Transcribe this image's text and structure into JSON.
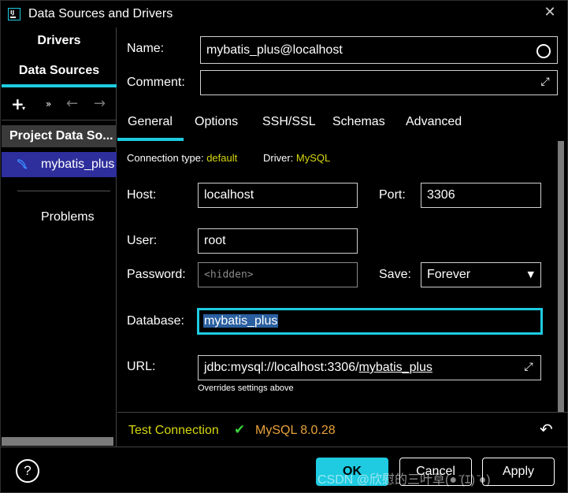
{
  "window": {
    "title": "Data Sources and Drivers",
    "close_glyph": "✕"
  },
  "sidebar": {
    "tabs": [
      "Drivers",
      "Data Sources"
    ],
    "toolbar": {
      "add": "+",
      "more": "»",
      "back": "←",
      "forward": "→"
    },
    "group_label": "Project Data So...",
    "items": [
      {
        "label": "mybatis_plus",
        "icon": "mysql-dolphin-icon"
      }
    ],
    "problems": "Problems"
  },
  "form": {
    "name_label": "Name:",
    "name_value": "mybatis_plus@localhost",
    "comment_label": "Comment:",
    "comment_value": "",
    "host_label": "Host:",
    "host_value": "localhost",
    "port_label": "Port:",
    "port_value": "3306",
    "user_label": "User:",
    "user_value": "root",
    "password_label": "Password:",
    "password_placeholder": "<hidden>",
    "save_label": "Save:",
    "save_value": "Forever",
    "database_label": "Database:",
    "database_value": "mybatis_plus",
    "url_label": "URL:",
    "url_prefix": "jdbc:mysql://localhost:3306/",
    "url_db": "mybatis_plus",
    "url_hint": "Overrides settings above"
  },
  "tabs": [
    "General",
    "Options",
    "SSH/SSL",
    "Schemas",
    "Advanced"
  ],
  "connection_info": {
    "type_label": "Connection type:",
    "type_value": "default",
    "driver_label": "Driver:",
    "driver_value": "MySQL"
  },
  "status": {
    "test_connection": "Test Connection",
    "check_glyph": "✔",
    "version": "MySQL 8.0.28",
    "revert_glyph": "↶"
  },
  "buttons": {
    "help": "?",
    "ok": "OK",
    "cancel": "Cancel",
    "apply": "Apply"
  },
  "watermark": "CSDN @欣慰的三叶草(● ̄(ｴ) ̄●)",
  "colors": {
    "accent": "#1ecbe1",
    "selection": "#2e2e9c",
    "yellow": "#d7d70f",
    "orange": "#e8a23c",
    "green": "#3bd13b"
  }
}
